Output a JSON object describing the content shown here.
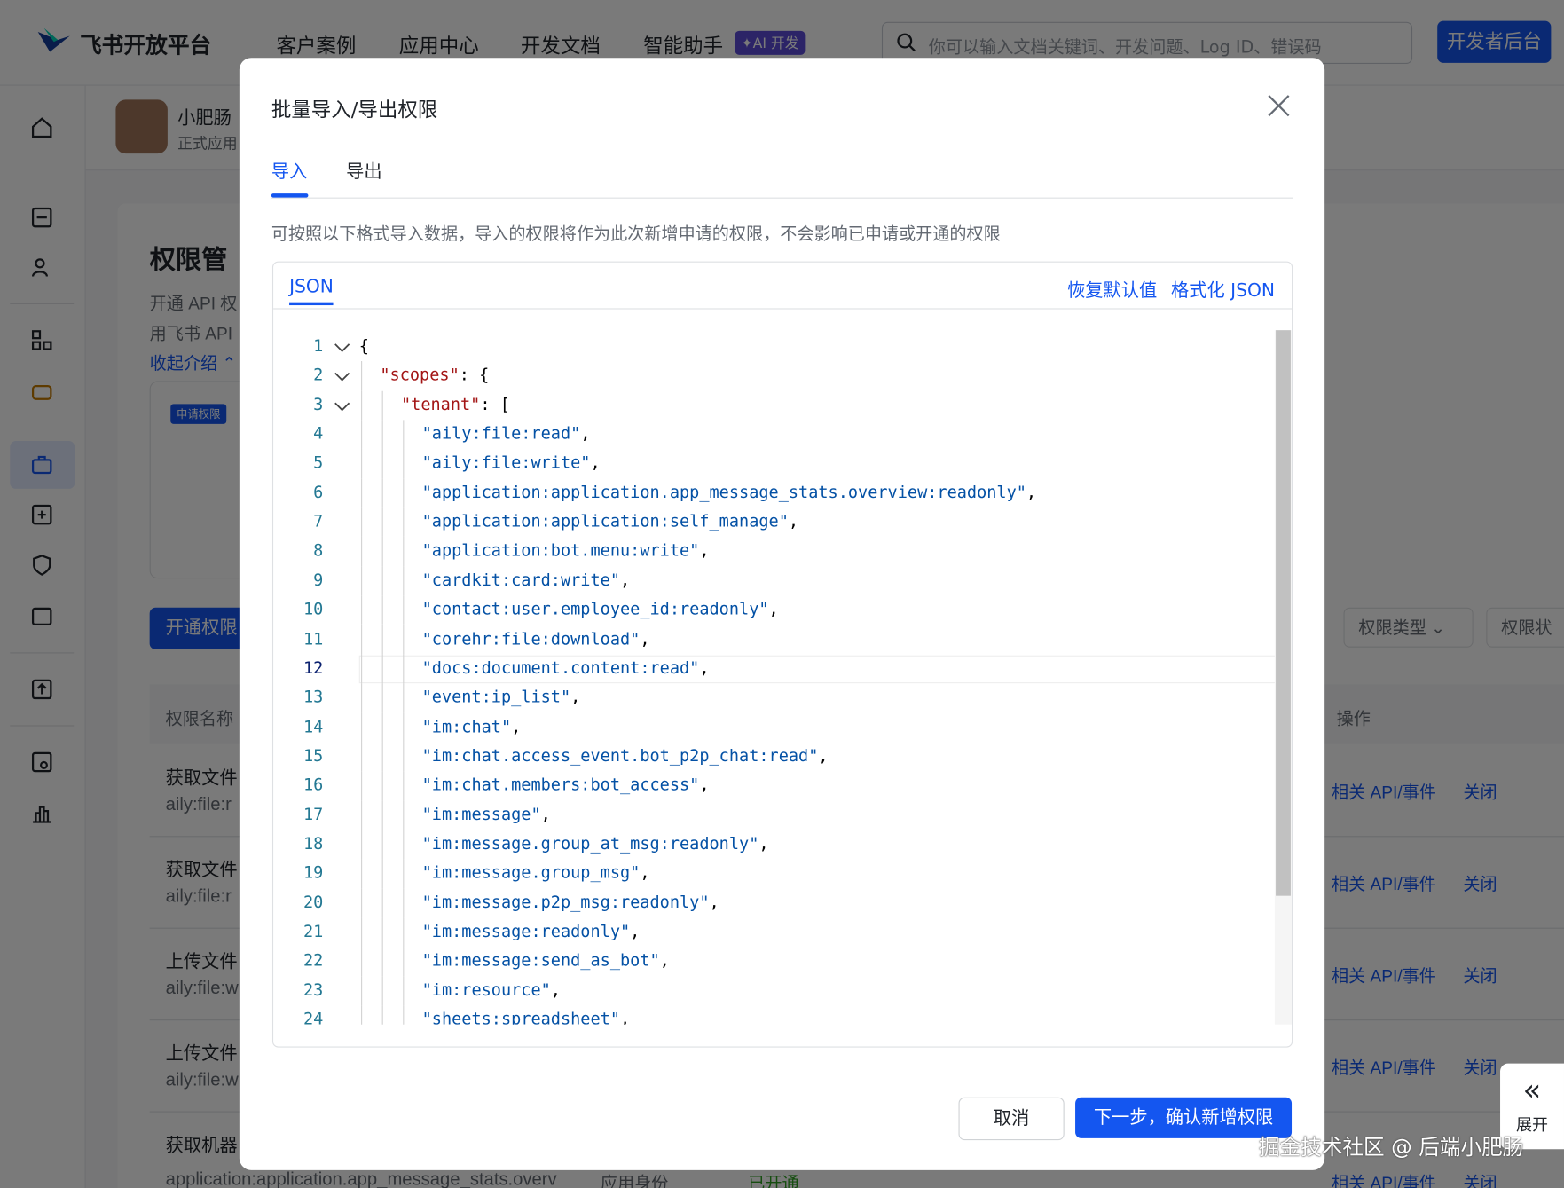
{
  "topnav": {
    "brand": "飞书开放平台",
    "items": [
      "客户案例",
      "应用中心",
      "开发文档",
      "智能助手"
    ],
    "ai_badge": "✦AI 开发",
    "search_placeholder": "你可以输入文档关键词、开发问题、Log ID、错误码",
    "dev_console": "开发者后台"
  },
  "app": {
    "name": "小肥肠",
    "status": "正式应用"
  },
  "page": {
    "title": "权限管",
    "intro_1": "开通 API 权",
    "intro_2": "用飞书 API",
    "collapse": "收起介绍 ⌃",
    "apply_tag": "申请权限",
    "open_btn": "开通权限",
    "filter_type": "权限类型",
    "filter_status": "权限状",
    "col_name": "权限名称",
    "col_ops": "操作",
    "rows": [
      {
        "name": "获取文件",
        "code": "aily:file:r"
      },
      {
        "name": "获取文件",
        "code": "aily:file:r"
      },
      {
        "name": "上传文件",
        "code": "aily:file:w"
      },
      {
        "name": "上传文件",
        "code": "aily:file:w"
      },
      {
        "name": "获取机器",
        "code": "application:application.app_message_stats.overv"
      }
    ],
    "row_identity": "应用身份",
    "row_state": "已开通",
    "op_api": "相关 API/事件",
    "op_close": "关闭"
  },
  "modal": {
    "title": "批量导入/导出权限",
    "tabs": [
      "导入",
      "导出"
    ],
    "active_tab": "导入",
    "description": "可按照以下格式导入数据，导入的权限将作为此次新增申请的权限，不会影响已申请或开通的权限",
    "editor": {
      "tab": "JSON",
      "reset": "恢复默认值",
      "format": "格式化 JSON",
      "current_line": 12,
      "lines": [
        {
          "n": "1",
          "indent": 0,
          "parts": [
            [
              "p",
              "{"
            ]
          ],
          "fold": true
        },
        {
          "n": "2",
          "indent": 1,
          "parts": [
            [
              "k",
              "\"scopes\""
            ],
            [
              "p",
              ": {"
            ]
          ],
          "fold": true
        },
        {
          "n": "3",
          "indent": 2,
          "parts": [
            [
              "k",
              "\"tenant\""
            ],
            [
              "p",
              ": ["
            ]
          ],
          "fold": true
        },
        {
          "n": "4",
          "indent": 3,
          "parts": [
            [
              "s",
              "\"aily:file:read\""
            ],
            [
              "p",
              ","
            ]
          ]
        },
        {
          "n": "5",
          "indent": 3,
          "parts": [
            [
              "s",
              "\"aily:file:write\""
            ],
            [
              "p",
              ","
            ]
          ]
        },
        {
          "n": "6",
          "indent": 3,
          "parts": [
            [
              "s",
              "\"application:application.app_message_stats.overview:readonly\""
            ],
            [
              "p",
              ","
            ]
          ]
        },
        {
          "n": "7",
          "indent": 3,
          "parts": [
            [
              "s",
              "\"application:application:self_manage\""
            ],
            [
              "p",
              ","
            ]
          ]
        },
        {
          "n": "8",
          "indent": 3,
          "parts": [
            [
              "s",
              "\"application:bot.menu:write\""
            ],
            [
              "p",
              ","
            ]
          ]
        },
        {
          "n": "9",
          "indent": 3,
          "parts": [
            [
              "s",
              "\"cardkit:card:write\""
            ],
            [
              "p",
              ","
            ]
          ]
        },
        {
          "n": "10",
          "indent": 3,
          "parts": [
            [
              "s",
              "\"contact:user.employee_id:readonly\""
            ],
            [
              "p",
              ","
            ]
          ]
        },
        {
          "n": "11",
          "indent": 3,
          "parts": [
            [
              "s",
              "\"corehr:file:download\""
            ],
            [
              "p",
              ","
            ]
          ]
        },
        {
          "n": "12",
          "indent": 3,
          "parts": [
            [
              "s",
              "\"docs:document.content:read\""
            ],
            [
              "p",
              ","
            ]
          ]
        },
        {
          "n": "13",
          "indent": 3,
          "parts": [
            [
              "s",
              "\"event:ip_list\""
            ],
            [
              "p",
              ","
            ]
          ]
        },
        {
          "n": "14",
          "indent": 3,
          "parts": [
            [
              "s",
              "\"im:chat\""
            ],
            [
              "p",
              ","
            ]
          ]
        },
        {
          "n": "15",
          "indent": 3,
          "parts": [
            [
              "s",
              "\"im:chat.access_event.bot_p2p_chat:read\""
            ],
            [
              "p",
              ","
            ]
          ]
        },
        {
          "n": "16",
          "indent": 3,
          "parts": [
            [
              "s",
              "\"im:chat.members:bot_access\""
            ],
            [
              "p",
              ","
            ]
          ]
        },
        {
          "n": "17",
          "indent": 3,
          "parts": [
            [
              "s",
              "\"im:message\""
            ],
            [
              "p",
              ","
            ]
          ]
        },
        {
          "n": "18",
          "indent": 3,
          "parts": [
            [
              "s",
              "\"im:message.group_at_msg:readonly\""
            ],
            [
              "p",
              ","
            ]
          ]
        },
        {
          "n": "19",
          "indent": 3,
          "parts": [
            [
              "s",
              "\"im:message.group_msg\""
            ],
            [
              "p",
              ","
            ]
          ]
        },
        {
          "n": "20",
          "indent": 3,
          "parts": [
            [
              "s",
              "\"im:message.p2p_msg:readonly\""
            ],
            [
              "p",
              ","
            ]
          ]
        },
        {
          "n": "21",
          "indent": 3,
          "parts": [
            [
              "s",
              "\"im:message:readonly\""
            ],
            [
              "p",
              ","
            ]
          ]
        },
        {
          "n": "22",
          "indent": 3,
          "parts": [
            [
              "s",
              "\"im:message:send_as_bot\""
            ],
            [
              "p",
              ","
            ]
          ]
        },
        {
          "n": "23",
          "indent": 3,
          "parts": [
            [
              "s",
              "\"im:resource\""
            ],
            [
              "p",
              ","
            ]
          ]
        },
        {
          "n": "24",
          "indent": 3,
          "parts": [
            [
              "s",
              "\"sheets:spreadsheet\""
            ],
            [
              "p",
              ","
            ]
          ]
        }
      ]
    },
    "cancel": "取消",
    "confirm": "下一步，确认新增权限"
  },
  "expand": "展开",
  "watermark": "掘金技术社区 @ 后端小肥肠",
  "colors": {
    "accent": "#1456f0",
    "json_key": "#a31515",
    "json_string": "#0451a5",
    "line_number": "#237893"
  }
}
